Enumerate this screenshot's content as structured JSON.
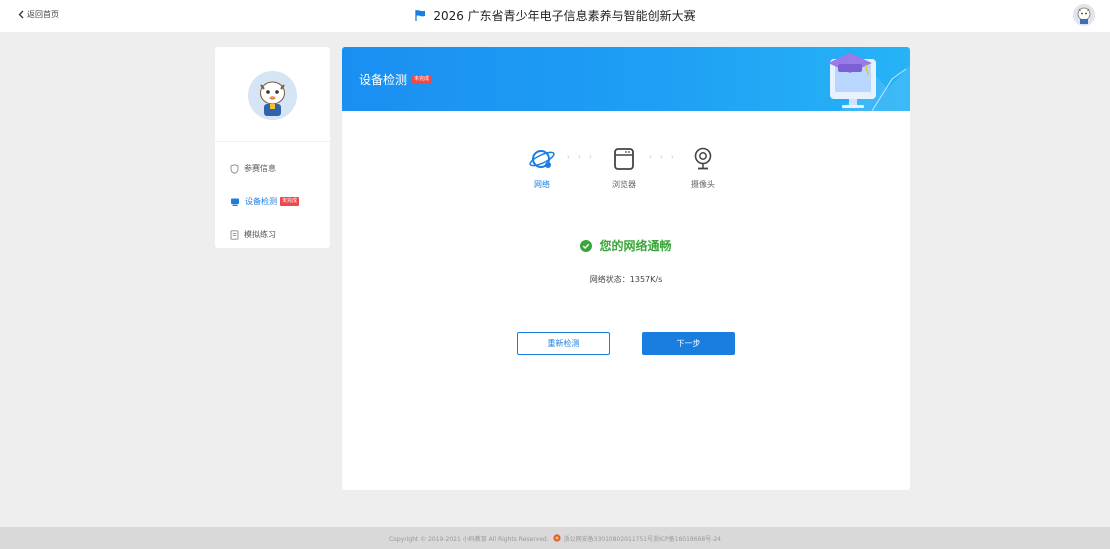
{
  "header": {
    "back_label": "返回首页",
    "title": "2026 广东省青少年电子信息素养与智能创新大赛"
  },
  "sidebar": {
    "items": [
      {
        "label": "参赛信息",
        "icon": "shield-icon"
      },
      {
        "label": "设备检测",
        "icon": "device-icon",
        "badge": "未完成"
      },
      {
        "label": "模拟练习",
        "icon": "document-icon"
      }
    ]
  },
  "main": {
    "title": "设备检测",
    "badge": "未完成",
    "steps": [
      {
        "label": "网络",
        "icon": "globe-icon"
      },
      {
        "label": "浏览器",
        "icon": "browser-icon"
      },
      {
        "label": "摄像头",
        "icon": "webcam-icon"
      }
    ],
    "step_arrows": "› › ›",
    "status_text": "您的网络通畅",
    "network_status": "网络状态：1357K/s",
    "retry_label": "重新检测",
    "next_label": "下一步"
  },
  "footer": {
    "copyright": "Copyright © 2019-2021 小码教育 All Rights Reserved.",
    "icp": "浙公网安备33010802011751号浙ICP备16018668号-24"
  },
  "colors": {
    "primary": "#1a7de0",
    "success": "#3aa63a",
    "badge": "#f04848"
  }
}
